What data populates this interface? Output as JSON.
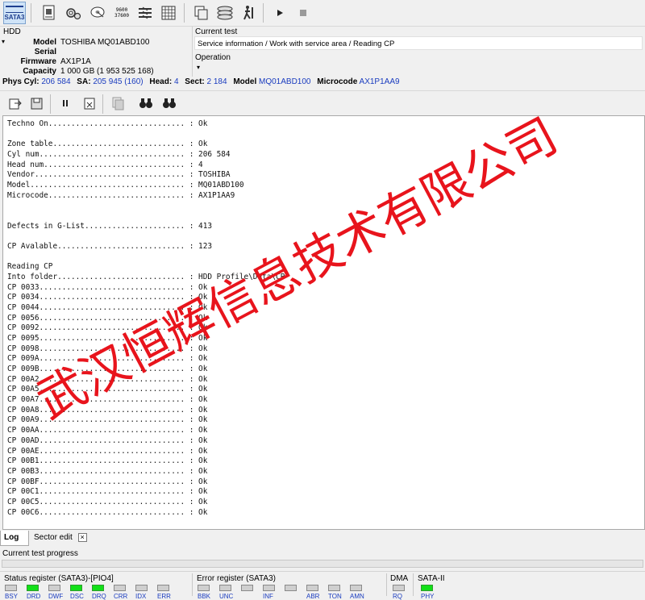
{
  "toolbar": {
    "sata_badge": "SATA3",
    "ico_sectors": "9600\n37600"
  },
  "hdd": {
    "title": "HDD",
    "fields": [
      {
        "label": "Model",
        "value": "TOSHIBA MQ01ABD100"
      },
      {
        "label": "Serial",
        "value": ""
      },
      {
        "label": "Firmware",
        "value": "AX1P1A"
      },
      {
        "label": "Capacity",
        "value": "1 000 GB (1 953 525 168)"
      }
    ]
  },
  "test": {
    "current_title": "Current test",
    "current_value": "Service information / Work with service area / Reading CP",
    "operation_title": "Operation",
    "operation_value": ""
  },
  "status": {
    "phys_cyl_label": "Phys Cyl:",
    "phys_cyl": "206 584",
    "sa_label": "SA:",
    "sa": "205 945 (160)",
    "head_label": "Head:",
    "head": "4",
    "sect_label": "Sect:",
    "sect": "2 184",
    "model_label": "Model",
    "model": "MQ01ABD100",
    "microcode_label": "Microcode",
    "microcode": "AX1P1AA9"
  },
  "log": {
    "lines": [
      "Techno On.............................. : Ok",
      "",
      "Zone table............................. : Ok",
      "Cyl num................................ : 206 584",
      "Head num............................... : 4",
      "Vendor................................. : TOSHIBA",
      "Model.................................. : MQ01ABD100",
      "Microcode.............................. : AX1P1AA9",
      "",
      "",
      "Defects in G-List...................... : 413",
      "",
      "CP Avalable............................ : 123",
      "",
      "Reading CP",
      "Into folder............................ : HDD Profile\\Data\\CP",
      "CP 0033................................ : Ok",
      "CP 0034................................ : Ok",
      "CP 0044................................ : Ok",
      "CP 0056................................ : Ok",
      "CP 0092................................ : Ok",
      "CP 0095................................ : Ok",
      "CP 0098................................ : Ok",
      "CP 009A................................ : Ok",
      "CP 009B................................ : Ok",
      "CP 00A2................................ : Ok",
      "CP 00A5................................ : Ok",
      "CP 00A7................................ : Ok",
      "CP 00A8................................ : Ok",
      "CP 00A9................................ : Ok",
      "CP 00AA................................ : Ok",
      "CP 00AD................................ : Ok",
      "CP 00AE................................ : Ok",
      "CP 00B1................................ : Ok",
      "CP 00B3................................ : Ok",
      "CP 00BF................................ : Ok",
      "CP 00C1................................ : Ok",
      "CP 00C5................................ : Ok",
      "CP 00C6................................ : Ok"
    ]
  },
  "watermark": {
    "text": "武汉恒辉信息技术有限公司",
    "color": "#e8141c"
  },
  "tabs": {
    "log": "Log",
    "sector_edit": "Sector edit",
    "close": "×"
  },
  "progress": {
    "label": "Current test progress",
    "value_percent": 0
  },
  "registers": {
    "status_title": "Status register (SATA3)-[PIO4]",
    "status_leds": [
      {
        "name": "BSY",
        "on": false
      },
      {
        "name": "DRD",
        "on": true
      },
      {
        "name": "DWF",
        "on": false
      },
      {
        "name": "DSC",
        "on": true
      },
      {
        "name": "DRQ",
        "on": true
      },
      {
        "name": "CRR",
        "on": false
      },
      {
        "name": "IDX",
        "on": false
      },
      {
        "name": "ERR",
        "on": false
      }
    ],
    "error_title": "Error register (SATA3)",
    "error_leds": [
      {
        "name": "BBK",
        "on": false
      },
      {
        "name": "UNC",
        "on": false
      },
      {
        "name": "",
        "on": false
      },
      {
        "name": "INF",
        "on": false
      },
      {
        "name": "",
        "on": false
      },
      {
        "name": "ABR",
        "on": false
      },
      {
        "name": "TON",
        "on": false
      },
      {
        "name": "AMN",
        "on": false
      }
    ],
    "dma_title": "DMA",
    "dma_leds": [
      {
        "name": "RQ",
        "on": false
      }
    ],
    "sata2_title": "SATA-II",
    "sata2_leds": [
      {
        "name": "PHY",
        "on": true
      }
    ]
  },
  "colors": {
    "value_blue": "#1a3cbf",
    "led_on": "#12e018"
  }
}
